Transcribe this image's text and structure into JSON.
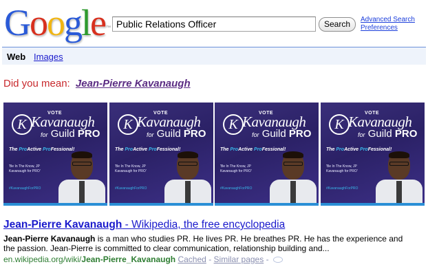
{
  "logo": {
    "letters": [
      "G",
      "o",
      "o",
      "g",
      "l",
      "e"
    ],
    "colors": [
      "#2a5ad7",
      "#d8301e",
      "#f0b513",
      "#2a5ad7",
      "#2e9a2e",
      "#d8301e"
    ],
    "tm": "™"
  },
  "search": {
    "value": "Public Relations Officer",
    "button_label": "Search"
  },
  "header_links": {
    "advanced": "Advanced Search",
    "preferences": "Preferences"
  },
  "tabs": {
    "web": "Web",
    "images": "Images"
  },
  "did_you_mean": {
    "prefix": "Did you mean:",
    "suggestion": "Jean-Pierre Kavanaugh"
  },
  "thumbnail": {
    "vote": "VOTE",
    "badge_letter": "K",
    "name": "Kavanaugh",
    "for_label": "for",
    "guild": "Guild",
    "pro": "PRO",
    "tag_the": "The ",
    "tag_pro": "Pro",
    "tag_active": "Active ",
    "tag_pro2": "Pro",
    "tag_fessional": "Fessional!",
    "quote": "'Be In The Know, JP Kavanaugh for PRO'",
    "hashtag": "#KavanaughForPRO",
    "count": 4
  },
  "result": {
    "title_bold": "Jean-Pierre Kavanaugh",
    "title_rest": " - Wikipedia, the free encyclopedia",
    "snippet_bold": "Jean-Pierre Kavanaugh",
    "snippet_rest": " is a man who studies PR. He lives PR. He breathes PR. He has the experience and the passion. Jean-Pierre is committed to clear communication, relationship building and...",
    "url_prefix": "en.wikipedia.org/wiki/",
    "url_bold": "Jean-Pierre_Kavanaugh",
    "cached": "Cached",
    "separator": "-",
    "similar": "Similar pages",
    "separator2": "-"
  }
}
